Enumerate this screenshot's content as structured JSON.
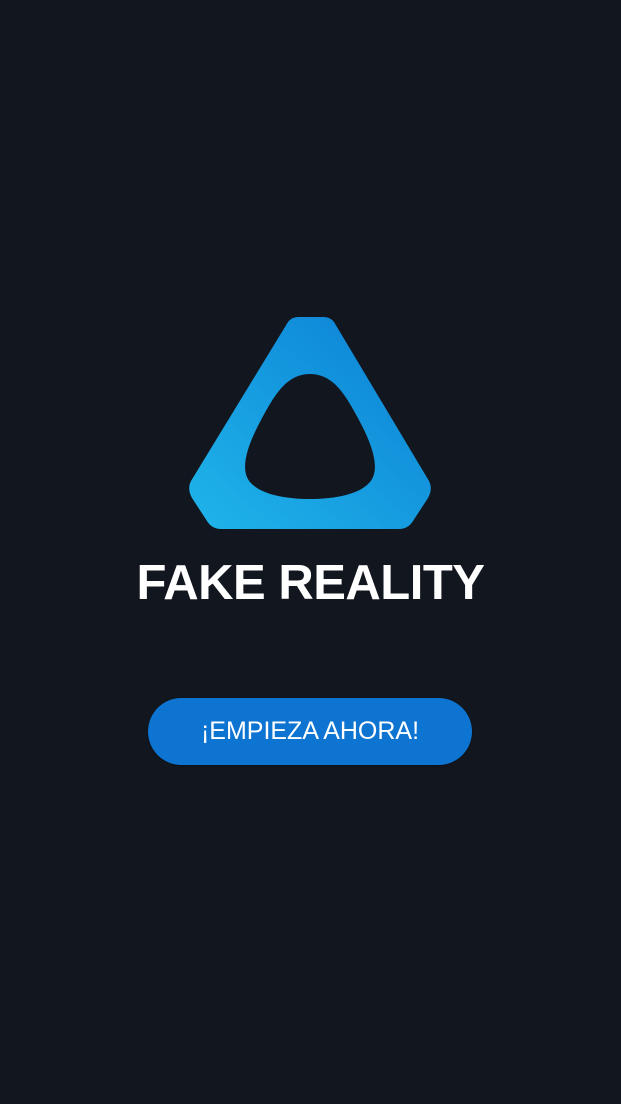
{
  "app": {
    "title": "FAKE REALITY"
  },
  "logo": {
    "icon": "rounded-triangle-logo-icon",
    "gradient_start": "#1fb5ea",
    "gradient_end": "#0c7fd4"
  },
  "actions": {
    "start_label": "¡EMPIEZA AHORA!"
  },
  "colors": {
    "background": "#12171f",
    "button": "#0d74d2",
    "text": "#ffffff"
  }
}
